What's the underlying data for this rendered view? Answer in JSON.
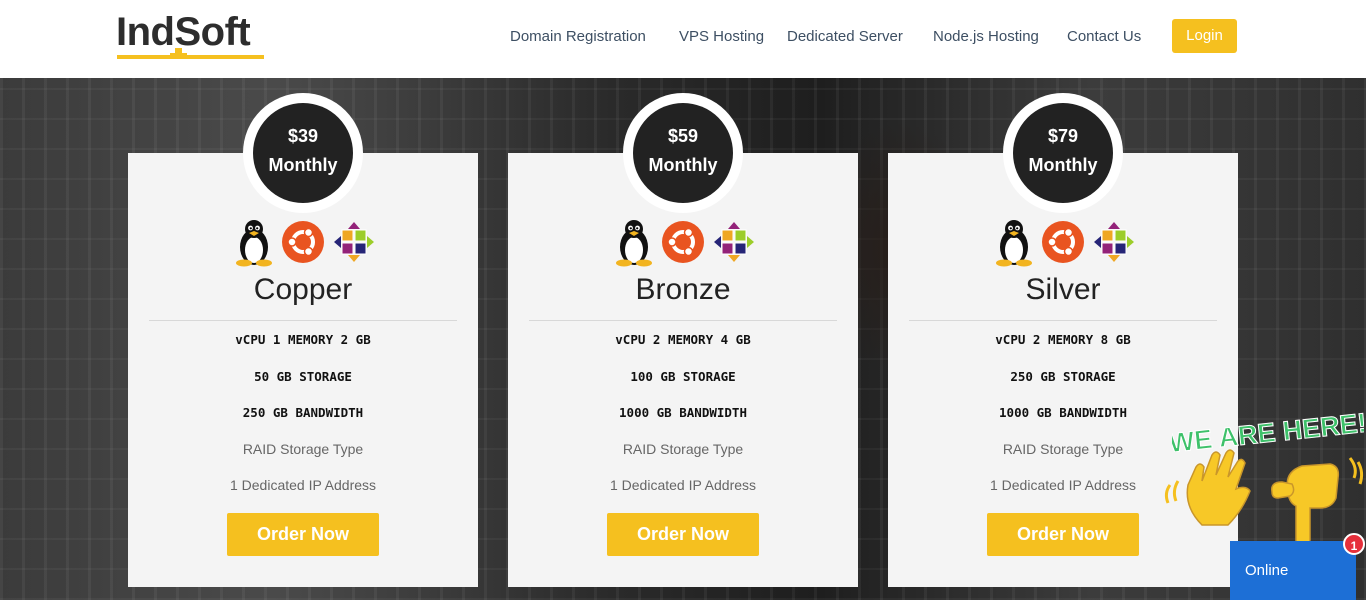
{
  "brand": {
    "name": "IndSoft"
  },
  "nav": {
    "items": [
      {
        "label": "Domain Registration"
      },
      {
        "label": "VPS Hosting"
      },
      {
        "label": "Dedicated Server"
      },
      {
        "label": "Node.js Hosting"
      },
      {
        "label": "Contact Us"
      }
    ],
    "login_label": "Login"
  },
  "colors": {
    "accent": "#f5c01f",
    "dark": "#222222",
    "card_bg": "#f4f4f4",
    "chat_blue": "#1d6fd6",
    "badge_red": "#e62f3b"
  },
  "plans": [
    {
      "price": "$39",
      "period": "Monthly",
      "name": "Copper",
      "specs_bold": [
        "vCPU 1 MEMORY 2 GB",
        "50 GB STORAGE",
        "250 GB BANDWIDTH"
      ],
      "specs_light": [
        "RAID Storage Type",
        "1 Dedicated IP Address"
      ],
      "os_icons": [
        "linux-tux-icon",
        "ubuntu-icon",
        "centos-icon"
      ],
      "order_label": "Order Now"
    },
    {
      "price": "$59",
      "period": "Monthly",
      "name": "Bronze",
      "specs_bold": [
        "vCPU 2 MEMORY 4 GB",
        "100 GB STORAGE",
        "1000 GB BANDWIDTH"
      ],
      "specs_light": [
        "RAID Storage Type",
        "1 Dedicated IP Address"
      ],
      "os_icons": [
        "linux-tux-icon",
        "ubuntu-icon",
        "centos-icon"
      ],
      "order_label": "Order Now"
    },
    {
      "price": "$79",
      "period": "Monthly",
      "name": "Silver",
      "specs_bold": [
        "vCPU 2 MEMORY 8 GB",
        "250 GB STORAGE",
        "1000 GB BANDWIDTH"
      ],
      "specs_light": [
        "RAID Storage Type",
        "1 Dedicated IP Address"
      ],
      "os_icons": [
        "linux-tux-icon",
        "ubuntu-icon",
        "centos-icon"
      ],
      "order_label": "Order Now"
    }
  ],
  "chat_widget": {
    "banner": "WE ARE HERE!",
    "status_label": "Online",
    "unread_count": "1",
    "icons": [
      "waving-hand-icon",
      "pointing-hand-icon"
    ]
  }
}
